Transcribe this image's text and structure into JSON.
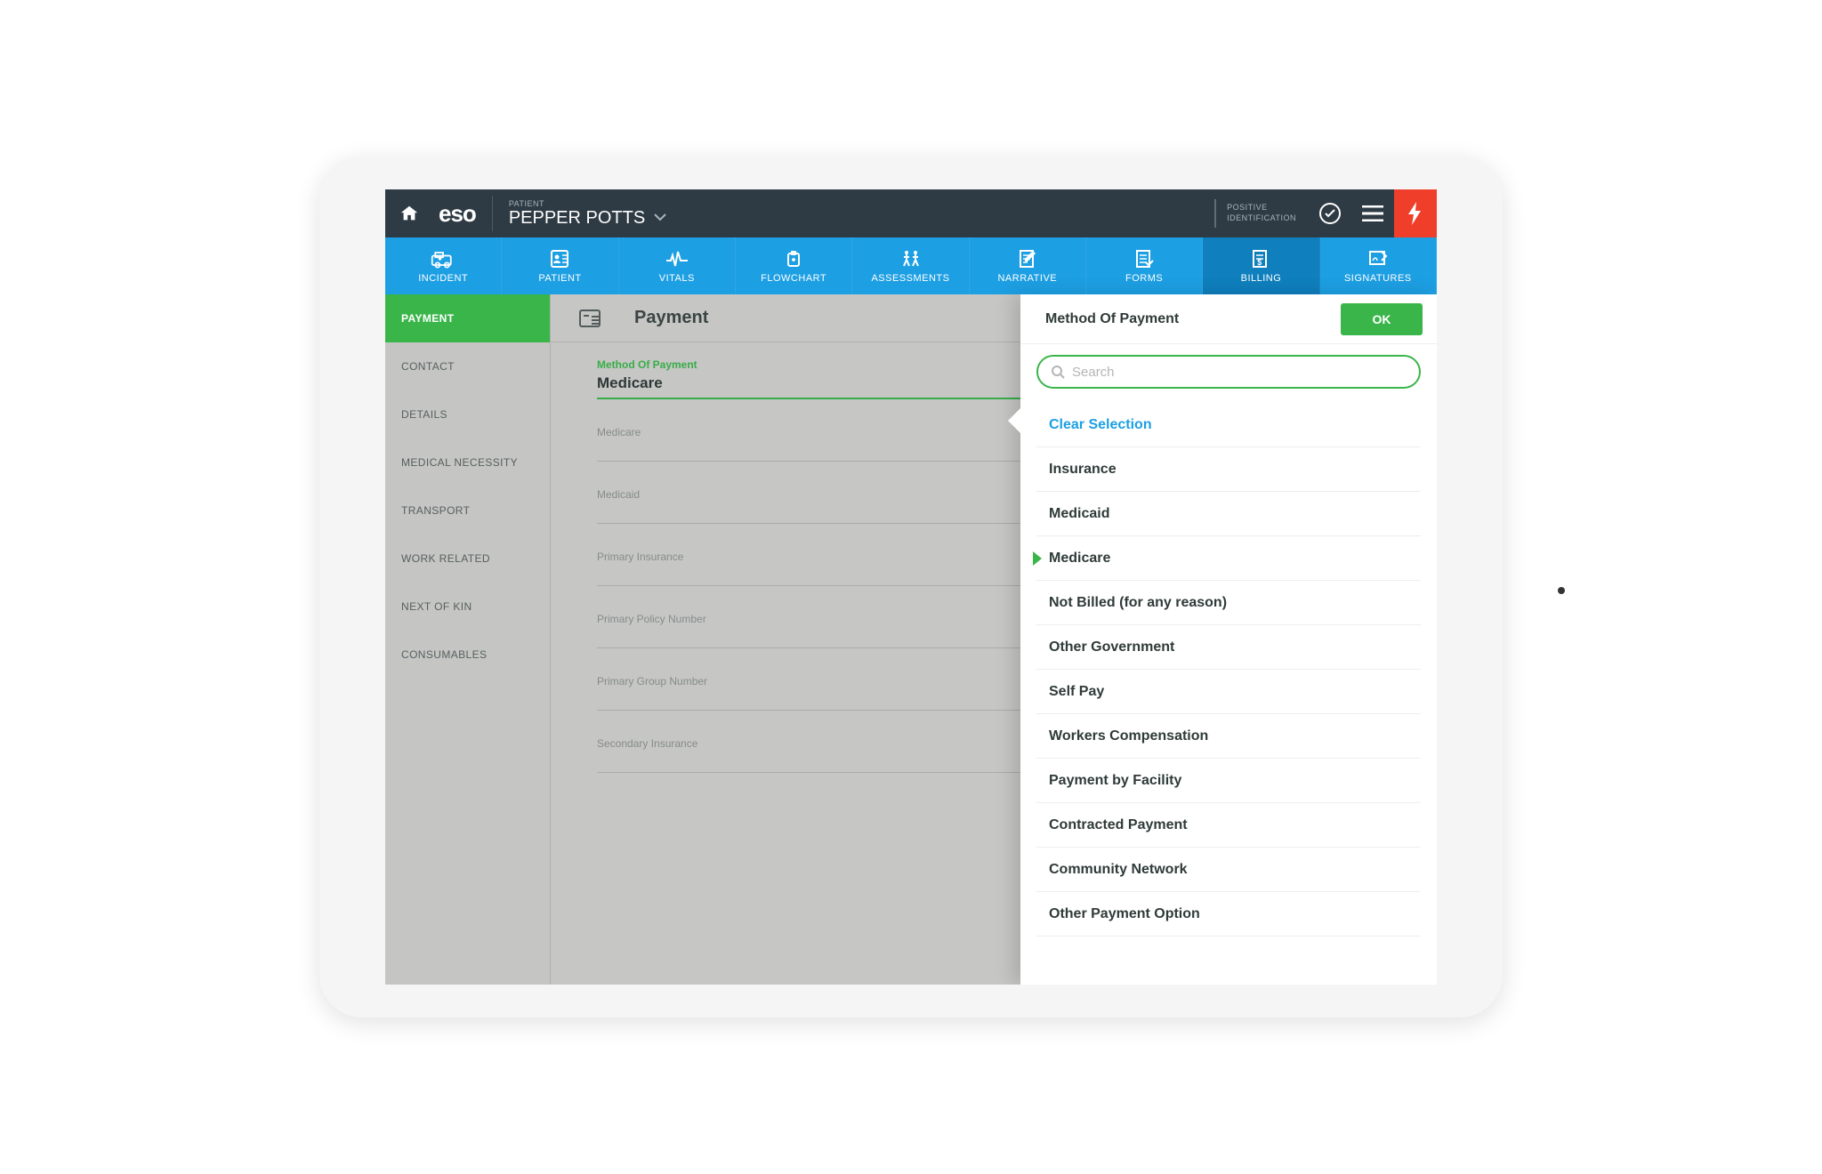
{
  "header": {
    "logo": "eso",
    "patient_label": "PATIENT",
    "patient_name": "PEPPER POTTS",
    "posid_line1": "POSITIVE",
    "posid_line2": "IDENTIFICATION"
  },
  "navtabs": [
    {
      "label": "INCIDENT"
    },
    {
      "label": "PATIENT"
    },
    {
      "label": "VITALS"
    },
    {
      "label": "FLOWCHART"
    },
    {
      "label": "ASSESSMENTS"
    },
    {
      "label": "NARRATIVE"
    },
    {
      "label": "FORMS"
    },
    {
      "label": "BILLING",
      "active": true
    },
    {
      "label": "SIGNATURES"
    }
  ],
  "sidebar": {
    "items": [
      {
        "label": "PAYMENT",
        "active": true
      },
      {
        "label": "CONTACT"
      },
      {
        "label": "DETAILS"
      },
      {
        "label": "MEDICAL NECESSITY"
      },
      {
        "label": "TRANSPORT"
      },
      {
        "label": "WORK RELATED"
      },
      {
        "label": "NEXT OF KIN"
      },
      {
        "label": "CONSUMABLES"
      }
    ]
  },
  "main": {
    "title": "Payment",
    "fields": [
      {
        "label": "Method Of Payment",
        "value": "Medicare",
        "focused": true
      },
      {
        "label": "Medicare"
      },
      {
        "label": "Medicaid"
      },
      {
        "label": "Primary Insurance"
      },
      {
        "label": "Primary Policy Number"
      },
      {
        "label": "Primary Group Number"
      },
      {
        "label": "Secondary Insurance"
      }
    ]
  },
  "panel": {
    "title": "Method Of Payment",
    "ok": "OK",
    "search_placeholder": "Search",
    "clear_label": "Clear Selection",
    "options": [
      {
        "label": "Insurance"
      },
      {
        "label": "Medicaid"
      },
      {
        "label": "Medicare",
        "selected": true
      },
      {
        "label": "Not Billed (for any reason)"
      },
      {
        "label": "Other Government"
      },
      {
        "label": "Self Pay"
      },
      {
        "label": "Workers Compensation"
      },
      {
        "label": "Payment by Facility"
      },
      {
        "label": "Contracted Payment"
      },
      {
        "label": "Community Network"
      },
      {
        "label": "Other Payment Option"
      }
    ]
  }
}
